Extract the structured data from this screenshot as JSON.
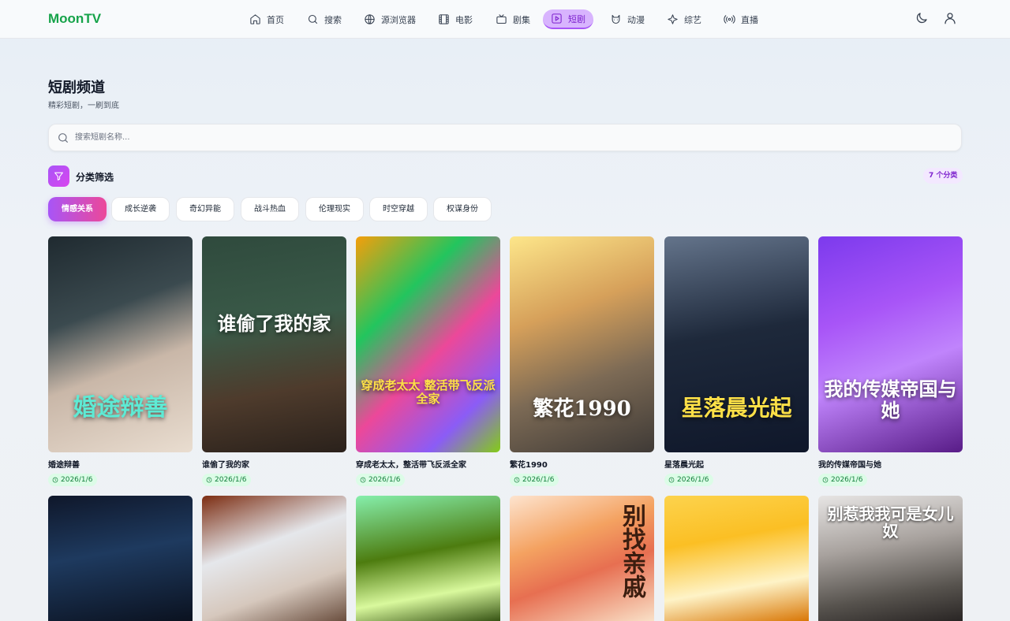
{
  "app": {
    "name": "MoonTV"
  },
  "nav": [
    {
      "label": "首页",
      "icon": "home-icon"
    },
    {
      "label": "搜索",
      "icon": "search-icon"
    },
    {
      "label": "源浏览器",
      "icon": "globe-icon"
    },
    {
      "label": "电影",
      "icon": "film-icon"
    },
    {
      "label": "剧集",
      "icon": "tv-icon"
    },
    {
      "label": "短剧",
      "icon": "play-square-icon",
      "active": true
    },
    {
      "label": "动漫",
      "icon": "cat-icon"
    },
    {
      "label": "综艺",
      "icon": "sparkle-icon"
    },
    {
      "label": "直播",
      "icon": "radio-icon"
    }
  ],
  "header": {
    "theme_icon": "moon-icon",
    "user_icon": "user-icon"
  },
  "page": {
    "title": "短剧频道",
    "subtitle": "精彩短剧，一刷到底"
  },
  "search": {
    "placeholder": "搜索短剧名称...",
    "value": ""
  },
  "filter": {
    "title": "分类筛选",
    "count": "7 个分类",
    "categories": [
      "情感关系",
      "成长逆袭",
      "奇幻异能",
      "战斗热血",
      "伦理现实",
      "时空穿越",
      "权谋身份"
    ],
    "selected": "情感关系"
  },
  "dramas": [
    {
      "title": "婚途辩善",
      "date": "2026/1/6",
      "poster_text": "婚途辩善"
    },
    {
      "title": "谁偷了我的家",
      "date": "2026/1/6",
      "poster_text": "谁偷了我的家"
    },
    {
      "title": "穿成老太太，整活带飞反派全家",
      "date": "2026/1/6",
      "poster_text": "穿成老太太 整活带飞反派全家"
    },
    {
      "title": "繁花1990",
      "date": "2026/1/6",
      "poster_text": "繁花1990"
    },
    {
      "title": "星落晨光起",
      "date": "2026/1/6",
      "poster_text": "星落晨光起"
    },
    {
      "title": "我的传媒帝国与她",
      "date": "2026/1/6",
      "poster_text": "我的传媒帝国与她"
    },
    {
      "poster_text": ""
    },
    {
      "poster_text": ""
    },
    {
      "poster_text": ""
    },
    {
      "poster_text": "别找亲戚"
    },
    {
      "poster_text": ""
    },
    {
      "poster_text": "别惹我我可是女儿奴"
    }
  ],
  "colors": {
    "brand": "#16a34a",
    "accent": "#a855f7",
    "date_badge_bg": "#dcfce7"
  }
}
